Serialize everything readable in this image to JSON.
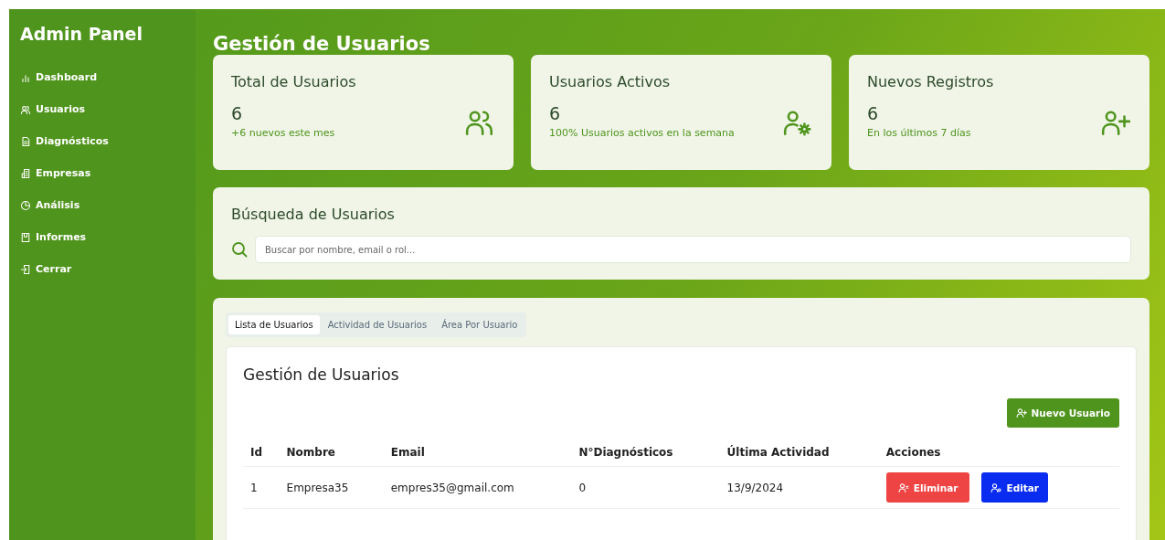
{
  "sidebar": {
    "title": "Admin Panel",
    "items": [
      {
        "label": "Dashboard",
        "kind": "chart"
      },
      {
        "label": "Usuarios",
        "kind": "users"
      },
      {
        "label": "Diagnósticos",
        "kind": "file"
      },
      {
        "label": "Empresas",
        "kind": "building"
      },
      {
        "label": "Análisis",
        "kind": "pie"
      },
      {
        "label": "Informes",
        "kind": "report"
      },
      {
        "label": "Cerrar",
        "kind": "logout"
      }
    ]
  },
  "page_title": "Gestión de Usuarios",
  "stats": [
    {
      "title": "Total de Usuarios",
      "value": "6",
      "note": "+6 nuevos este mes",
      "kind": "users"
    },
    {
      "title": "Usuarios Activos",
      "value": "6",
      "note": "100% Usuarios activos en la semana",
      "kind": "user-gear"
    },
    {
      "title": "Nuevos Registros",
      "value": "6",
      "note": "En los últimos 7 días",
      "kind": "user-plus"
    }
  ],
  "search": {
    "title": "Búsqueda de Usuarios",
    "placeholder": "Buscar por nombre, email o rol..."
  },
  "tabs": [
    {
      "label": "Lista de Usuarios",
      "selected": true
    },
    {
      "label": "Actividad de Usuarios",
      "selected": false
    },
    {
      "label": "Área Por Usuario",
      "selected": false
    }
  ],
  "panel": {
    "title": "Gestión de Usuarios",
    "new_button": "Nuevo Usuario"
  },
  "table": {
    "columns": [
      "Id",
      "Nombre",
      "Email",
      "N°Diagnósticos",
      "Última Actividad",
      "Acciones"
    ],
    "rows": [
      {
        "cells": [
          "1",
          "Empresa35",
          "empres35@gmail.com",
          "0",
          "13/9/2024"
        ],
        "delete": "Eliminar",
        "edit": "Editar"
      }
    ]
  }
}
